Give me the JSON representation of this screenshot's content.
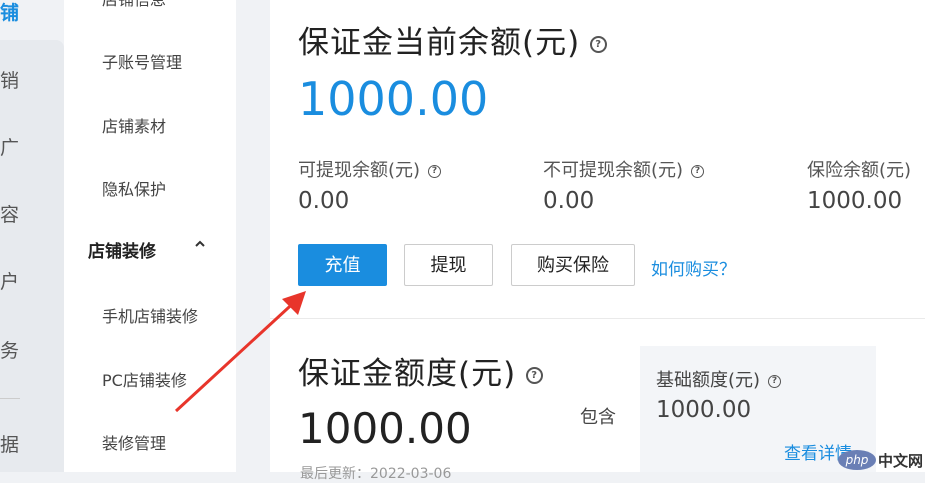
{
  "nav_primary": [
    {
      "label": "铺",
      "active": true
    },
    {
      "label": "销"
    },
    {
      "label": "广"
    },
    {
      "label": "容"
    },
    {
      "label": "户"
    },
    {
      "label": "务"
    },
    {
      "label": "据"
    }
  ],
  "nav_secondary": {
    "items": [
      {
        "label": "店铺信息"
      },
      {
        "label": "子账号管理"
      },
      {
        "label": "店铺素材"
      },
      {
        "label": "隐私保护"
      }
    ],
    "group": {
      "label": "店铺装修",
      "expanded": true,
      "icon": "chevron-up-icon"
    },
    "group_items": [
      {
        "label": "手机店铺装修"
      },
      {
        "label": "PC店铺装修"
      },
      {
        "label": "装修管理"
      }
    ]
  },
  "deposit": {
    "title": "保证金当前余额(元)",
    "amount": "1000.00",
    "stats": [
      {
        "label": "可提现余额(元)",
        "value": "0.00"
      },
      {
        "label": "不可提现余额(元)",
        "value": "0.00"
      },
      {
        "label": "保险余额(元)",
        "value": "1000.00"
      }
    ],
    "buttons": {
      "recharge": "充值",
      "withdraw": "提现",
      "buy_insurance": "购买保险"
    },
    "how_to_buy": "如何购买？"
  },
  "quota": {
    "title": "保证金额度(元)",
    "amount": "1000.00",
    "updated_label": "最后更新：2022-03-06",
    "contains": "包含",
    "base": {
      "label": "基础额度(元)",
      "value": "1000.00",
      "details_link": "查看详情"
    }
  },
  "colors": {
    "accent": "#1a8ddf",
    "annotation": "#e8352b"
  },
  "watermark": {
    "logo": "php",
    "text": "中文网"
  }
}
